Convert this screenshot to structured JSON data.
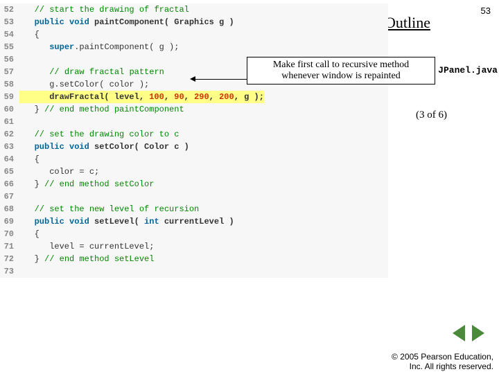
{
  "page_number": "53",
  "outline_label": "Outline",
  "callout": {
    "line1": "Make first call to recursive method",
    "line2": "whenever window is repainted"
  },
  "file_label": "JPanel.java",
  "part_of": "(3 of 6)",
  "copyright": {
    "line1": "© 2005 Pearson Education,",
    "line2": "Inc. All rights reserved."
  },
  "code": {
    "lines": [
      {
        "n": "52",
        "tokens": [
          {
            "t": "   ",
            "c": ""
          },
          {
            "t": "// start the drawing of fractal",
            "c": "cm"
          }
        ]
      },
      {
        "n": "53",
        "tokens": [
          {
            "t": "   ",
            "c": ""
          },
          {
            "t": "public void",
            "c": "kw"
          },
          {
            "t": " ",
            "c": ""
          },
          {
            "t": "paintComponent( Graphics g )",
            "c": "id bold"
          }
        ]
      },
      {
        "n": "54",
        "tokens": [
          {
            "t": "   {",
            "c": "id"
          }
        ]
      },
      {
        "n": "55",
        "tokens": [
          {
            "t": "      ",
            "c": ""
          },
          {
            "t": "super",
            "c": "kw"
          },
          {
            "t": ".paintComponent( g );",
            "c": "id"
          }
        ]
      },
      {
        "n": "56",
        "tokens": [
          {
            "t": "",
            "c": ""
          }
        ]
      },
      {
        "n": "57",
        "tokens": [
          {
            "t": "      ",
            "c": ""
          },
          {
            "t": "// draw fractal pattern",
            "c": "cm"
          }
        ]
      },
      {
        "n": "58",
        "tokens": [
          {
            "t": "      g.setColor( color );",
            "c": "id"
          }
        ]
      },
      {
        "n": "59",
        "hl": true,
        "tokens": [
          {
            "t": "      drawFractal( level, ",
            "c": "id bold"
          },
          {
            "t": "100",
            "c": "num bold"
          },
          {
            "t": ", ",
            "c": "id bold"
          },
          {
            "t": "90",
            "c": "num bold"
          },
          {
            "t": ", ",
            "c": "id bold"
          },
          {
            "t": "290",
            "c": "num bold"
          },
          {
            "t": ", ",
            "c": "id bold"
          },
          {
            "t": "200",
            "c": "num bold"
          },
          {
            "t": ", g );",
            "c": "id bold"
          }
        ]
      },
      {
        "n": "60",
        "tokens": [
          {
            "t": "   } ",
            "c": "id"
          },
          {
            "t": "// end method paintComponent",
            "c": "cm"
          }
        ]
      },
      {
        "n": "61",
        "tokens": [
          {
            "t": "",
            "c": ""
          }
        ]
      },
      {
        "n": "62",
        "tokens": [
          {
            "t": "   ",
            "c": ""
          },
          {
            "t": "// set the drawing color to c",
            "c": "cm"
          }
        ]
      },
      {
        "n": "63",
        "tokens": [
          {
            "t": "   ",
            "c": ""
          },
          {
            "t": "public void",
            "c": "kw"
          },
          {
            "t": " ",
            "c": ""
          },
          {
            "t": "setColor( Color c )",
            "c": "id bold"
          }
        ]
      },
      {
        "n": "64",
        "tokens": [
          {
            "t": "   {",
            "c": "id"
          }
        ]
      },
      {
        "n": "65",
        "tokens": [
          {
            "t": "      color = c;",
            "c": "id"
          }
        ]
      },
      {
        "n": "66",
        "tokens": [
          {
            "t": "   } ",
            "c": "id"
          },
          {
            "t": "// end method setColor",
            "c": "cm"
          }
        ]
      },
      {
        "n": "67",
        "tokens": [
          {
            "t": "",
            "c": ""
          }
        ]
      },
      {
        "n": "68",
        "tokens": [
          {
            "t": "   ",
            "c": ""
          },
          {
            "t": "// set the new level of recursion",
            "c": "cm"
          }
        ]
      },
      {
        "n": "69",
        "tokens": [
          {
            "t": "   ",
            "c": ""
          },
          {
            "t": "public void",
            "c": "kw"
          },
          {
            "t": " ",
            "c": ""
          },
          {
            "t": "setLevel( ",
            "c": "id bold"
          },
          {
            "t": "int",
            "c": "kw"
          },
          {
            "t": " currentLevel )",
            "c": "id bold"
          }
        ]
      },
      {
        "n": "70",
        "tokens": [
          {
            "t": "   {",
            "c": "id"
          }
        ]
      },
      {
        "n": "71",
        "tokens": [
          {
            "t": "      level = currentLevel;",
            "c": "id"
          }
        ]
      },
      {
        "n": "72",
        "tokens": [
          {
            "t": "   } ",
            "c": "id"
          },
          {
            "t": "// end method setLevel",
            "c": "cm"
          }
        ]
      },
      {
        "n": "73",
        "tokens": [
          {
            "t": "",
            "c": ""
          }
        ]
      }
    ]
  }
}
